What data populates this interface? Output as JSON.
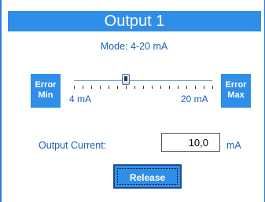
{
  "panel": {
    "title": "Output 1",
    "mode_text": "Mode: 4-20 mA"
  },
  "error_min": {
    "line1": "Error",
    "line2": "Min"
  },
  "error_max": {
    "line1": "Error",
    "line2": "Max"
  },
  "slider": {
    "min_label": "4 mA",
    "max_label": "20 mA",
    "min_value": 4,
    "max_value": 20,
    "value": 10.0
  },
  "output_current": {
    "label": "Output Current:",
    "value": "10,0",
    "unit": "mA"
  },
  "release_button": {
    "label": "Release"
  },
  "colors": {
    "accent": "#2f8ee8",
    "text": "#1a5fb4",
    "border": "#2a7fd8"
  }
}
